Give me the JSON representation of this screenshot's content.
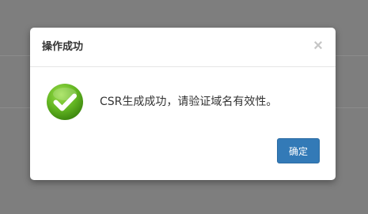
{
  "dialog": {
    "title": "操作成功",
    "close_label": "×",
    "message": "CSR生成成功，请验证域名有效性。",
    "confirm_label": "确定",
    "icon": "success-check-icon"
  },
  "colors": {
    "primary_button": "#337ab7",
    "success_green": "#5fb31e",
    "backdrop": "#7e7e7e"
  }
}
